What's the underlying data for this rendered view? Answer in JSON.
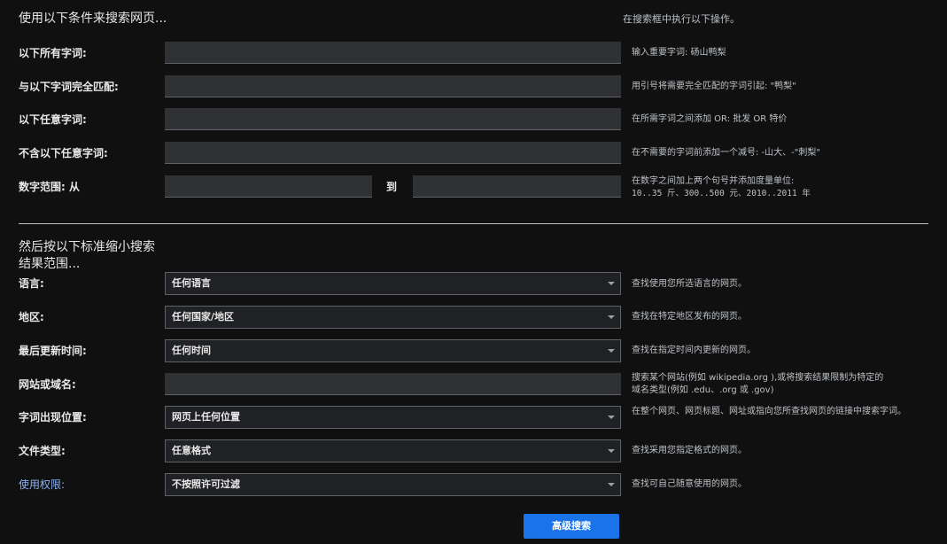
{
  "find_pages": {
    "title": "使用以下条件来搜索网页...",
    "header_hint": "在搜索框中执行以下操作。",
    "rows": [
      {
        "label": "以下所有字词:",
        "hint": "输入重要字词: 砀山鸭梨"
      },
      {
        "label": "与以下字词完全匹配:",
        "hint": "用引号将需要完全匹配的字词引起: \"鸭梨\""
      },
      {
        "label": "以下任意字词:",
        "hint": "在所需字词之间添加 OR: 批发 OR 特价"
      },
      {
        "label": "不含以下任意字词:",
        "hint": "在不需要的字词前添加一个减号: -山大、-\"刺梨\""
      },
      {
        "label": "数字范围: 从",
        "to_label": "到",
        "hint_line1": "在数字之间加上两个句号并添加度量单位:",
        "hint_line2": "10..35 斤、300..500 元、2010..2011 年"
      }
    ]
  },
  "narrow": {
    "title": "然后按以下标准缩小搜索结果范围...",
    "language": {
      "label": "语言:",
      "value": "任何语言",
      "hint": "查找使用您所选语言的网页。"
    },
    "region": {
      "label": "地区:",
      "value": "任何国家/地区",
      "hint": "查找在特定地区发布的网页。"
    },
    "last_update": {
      "label": "最后更新时间:",
      "value": "任何时间",
      "hint": "查找在指定时间内更新的网页。"
    },
    "site": {
      "label": "网站或域名:",
      "hint_line1": "搜索某个网站(例如 wikipedia.org ),或将搜索结果限制为特定的",
      "hint_line2": "域名类型(例如 .edu、.org 或 .gov)"
    },
    "terms_appearing": {
      "label": "字词出现位置:",
      "value": "网页上任何位置",
      "hint": "在整个网页、网页标题、网址或指向您所查找网页的链接中搜索字词。"
    },
    "file_type": {
      "label": "文件类型:",
      "value": "任意格式",
      "hint": "查找采用您指定格式的网页。"
    },
    "usage_rights": {
      "label": "使用权限:",
      "value": "不按照许可过滤",
      "hint": "查找可自己随意使用的网页。"
    }
  },
  "submit": {
    "label": "高级搜索"
  }
}
